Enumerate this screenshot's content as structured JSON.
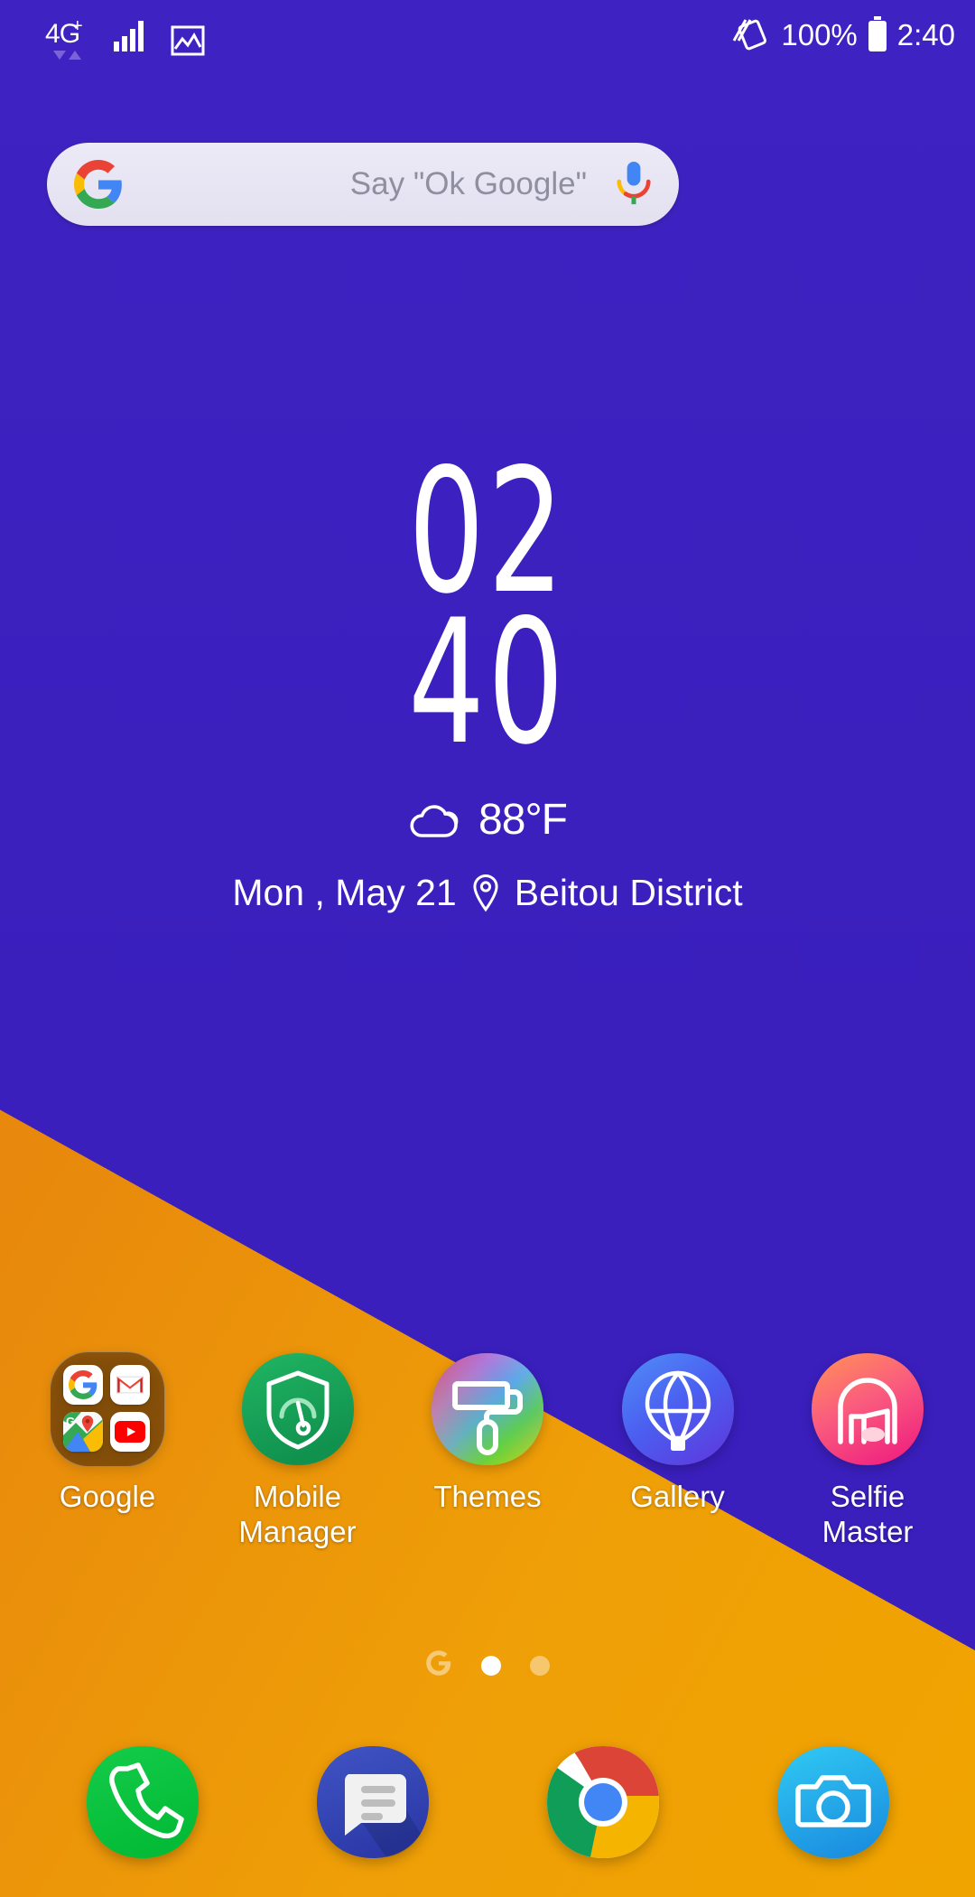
{
  "theme": {
    "wallpaper_blue": "#3a1fbd",
    "wallpaper_orange": "#e8890c",
    "text_white": "#ffffff"
  },
  "status_bar": {
    "network_type": "4",
    "network_suffix": "G",
    "network_plus": "+",
    "signal_icon": "signal-bars-icon",
    "data_arrows_icon": "data-transfer-arrows-icon",
    "screenshot_icon": "screenshot-image-icon",
    "rotate_icon": "auto-rotate-icon",
    "battery_percent": "100%",
    "battery_icon": "battery-full-icon",
    "clock": "2:40"
  },
  "search": {
    "google_logo": "google-g-logo",
    "placeholder": "Say \"Ok Google\"",
    "mic_icon": "google-microphone-icon"
  },
  "clock_widget": {
    "hours": "02",
    "minutes": "40",
    "weather_icon": "cloud-icon",
    "temperature": "88°F",
    "date": "Mon , May 21",
    "location_icon": "location-pin-icon",
    "location": "Beitou District"
  },
  "apps": [
    {
      "label": "Google",
      "icon": "google-folder-icon",
      "type": "folder",
      "contents": [
        {
          "label": "Google",
          "icon": "google-g-logo"
        },
        {
          "label": "Gmail",
          "icon": "gmail-icon"
        },
        {
          "label": "Maps",
          "icon": "google-maps-icon"
        },
        {
          "label": "YouTube",
          "icon": "youtube-icon"
        }
      ]
    },
    {
      "label": "Mobile\nManager",
      "icon": "mobile-manager-shield-icon",
      "type": "app"
    },
    {
      "label": "Themes",
      "icon": "themes-paint-roller-icon",
      "type": "app"
    },
    {
      "label": "Gallery",
      "icon": "gallery-hot-air-balloon-icon",
      "type": "app"
    },
    {
      "label": "Selfie\nMaster",
      "icon": "selfie-master-face-icon",
      "type": "app"
    }
  ],
  "page_indicator": {
    "google_glyph": "G",
    "pages": 2,
    "active_page": 1
  },
  "dock": [
    {
      "label": "Phone",
      "icon": "phone-handset-icon"
    },
    {
      "label": "Messages",
      "icon": "messages-bubble-icon"
    },
    {
      "label": "Chrome",
      "icon": "chrome-icon"
    },
    {
      "label": "Camera",
      "icon": "camera-icon"
    }
  ]
}
